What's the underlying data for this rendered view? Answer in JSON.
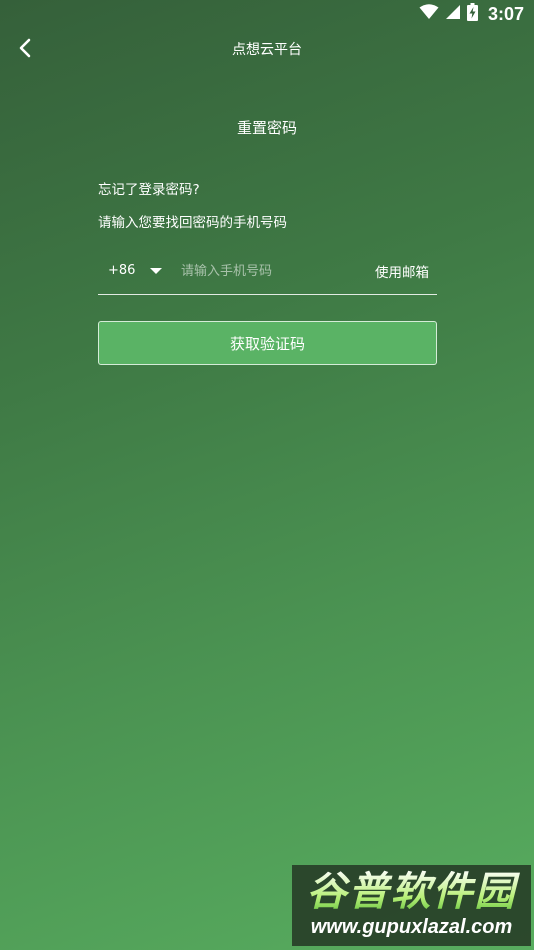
{
  "status_bar": {
    "time": "3:07",
    "icons": [
      "wifi-icon",
      "signal-icon",
      "battery-charging-icon"
    ]
  },
  "header": {
    "title": "点想云平台",
    "back_icon": "chevron-left-icon"
  },
  "page": {
    "title": "重置密码",
    "question": "忘记了登录密码?",
    "instruction": "请输入您要找回密码的手机号码"
  },
  "phone_form": {
    "country_code": "+86",
    "phone_placeholder": "请输入手机号码",
    "phone_value": "",
    "use_email_label": "使用邮箱"
  },
  "actions": {
    "get_code_label": "获取验证码"
  },
  "watermark": {
    "logo_text": "谷普软件园",
    "url": "www.gupuxlazal.com"
  },
  "colors": {
    "background_top": "#35603a",
    "background_bottom": "#58ad5f",
    "button": "#5ab365",
    "text": "#ffffff"
  }
}
